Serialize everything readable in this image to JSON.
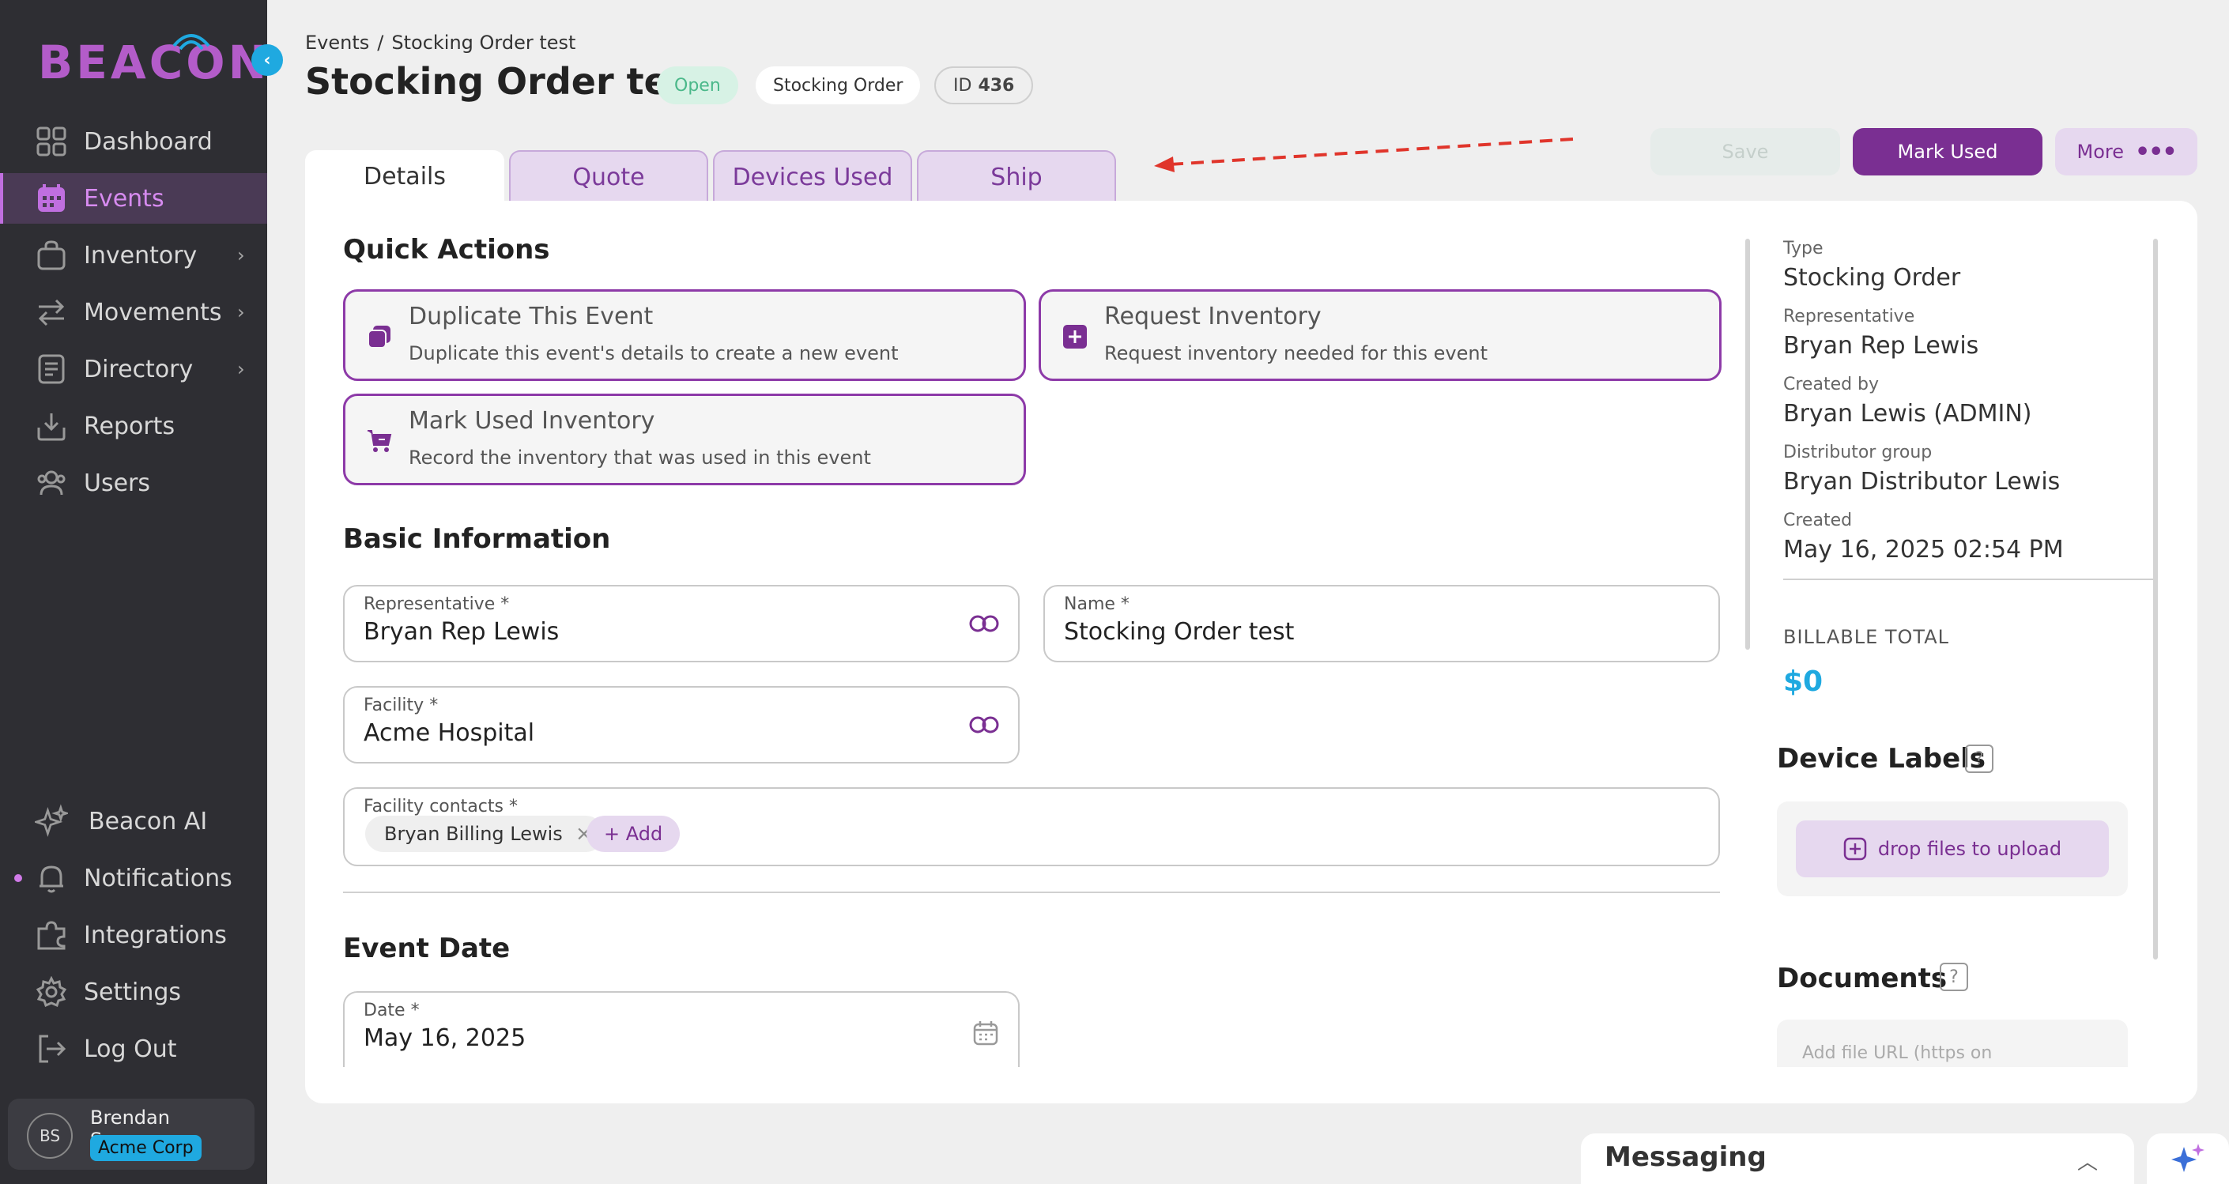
{
  "brand": {
    "logo_text": "BEACON"
  },
  "sidebar": {
    "collapse_icon": "chevron-left-icon",
    "items": [
      {
        "label": "Dashboard",
        "icon": "grid-icon"
      },
      {
        "label": "Events",
        "icon": "calendar-icon",
        "active": true
      },
      {
        "label": "Inventory",
        "icon": "bag-icon",
        "has_submenu": true
      },
      {
        "label": "Movements",
        "icon": "arrows-icon",
        "has_submenu": true
      },
      {
        "label": "Directory",
        "icon": "document-icon",
        "has_submenu": true
      },
      {
        "label": "Reports",
        "icon": "download-icon"
      },
      {
        "label": "Users",
        "icon": "users-icon"
      }
    ],
    "bottom_items": [
      {
        "label": "Beacon AI",
        "icon": "sparkles-icon"
      },
      {
        "label": "Notifications",
        "icon": "bell-icon",
        "has_dot": true
      },
      {
        "label": "Integrations",
        "icon": "puzzle-icon"
      },
      {
        "label": "Settings",
        "icon": "gear-icon"
      },
      {
        "label": "Log Out",
        "icon": "logout-icon"
      }
    ],
    "user": {
      "initials": "BS",
      "name": "Brendan Sweeney",
      "org": "Acme Corp"
    }
  },
  "header": {
    "breadcrumb": [
      "Events",
      "/",
      "Stocking Order test"
    ],
    "title": "Stocking Order test",
    "status": "Open",
    "type": "Stocking Order",
    "id_label": "ID",
    "id_value": "436"
  },
  "tabs": [
    "Details",
    "Quote",
    "Devices Used",
    "Ship"
  ],
  "actions": {
    "save": "Save",
    "mark_used": "Mark Used",
    "more": "More"
  },
  "quick_actions": {
    "title": "Quick Actions",
    "items": [
      {
        "title": "Duplicate This Event",
        "desc": "Duplicate this event's details to create a new event"
      },
      {
        "title": "Request Inventory",
        "desc": "Request inventory needed for this event"
      },
      {
        "title": "Mark Used Inventory",
        "desc": "Record the inventory that was used in this event"
      }
    ]
  },
  "basic_info": {
    "title": "Basic Information",
    "representative": {
      "label": "Representative *",
      "value": "Bryan Rep Lewis"
    },
    "name": {
      "label": "Name *",
      "value": "Stocking Order test"
    },
    "facility": {
      "label": "Facility *",
      "value": "Acme Hospital"
    },
    "contacts": {
      "label": "Facility contacts *",
      "chip": "Bryan Billing Lewis",
      "add": "+ Add"
    }
  },
  "event_date": {
    "title": "Event Date",
    "date": {
      "label": "Date *",
      "value": "May 16, 2025"
    }
  },
  "details_sidebar": {
    "type_label": "Type",
    "type_value": "Stocking Order",
    "rep_label": "Representative",
    "rep_value": "Bryan Rep Lewis",
    "created_by_label": "Created by",
    "created_by_value": "Bryan Lewis (ADMIN)",
    "dist_label": "Distributor group",
    "dist_value": "Bryan Distributor Lewis",
    "created_label": "Created",
    "created_value": "May 16, 2025 02:54 PM",
    "billable_label": "BILLABLE TOTAL",
    "billable_value": "$0",
    "device_labels_title": "Device Labels",
    "upload_label": "drop files to upload",
    "documents_title": "Documents",
    "url_placeholder": "Add file URL (https on"
  },
  "messaging": {
    "title": "Messaging"
  },
  "colors": {
    "brand_purple": "#7a2f92",
    "accent_cyan": "#1fa9e0",
    "open_green": "#4bb88a",
    "sidebar_bg": "#2e2e33"
  }
}
